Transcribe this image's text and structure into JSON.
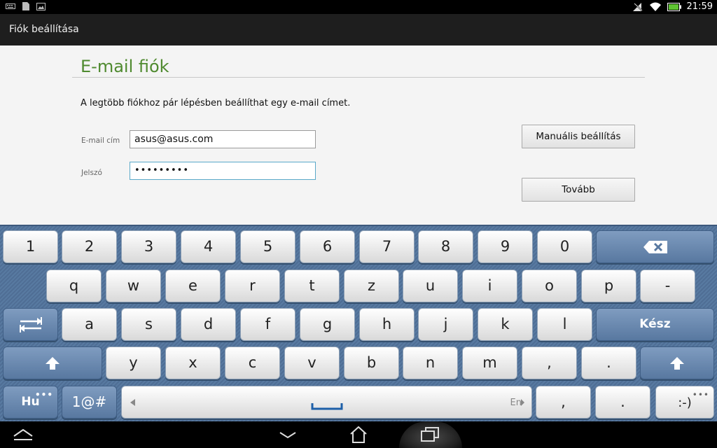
{
  "status": {
    "time": "21:59"
  },
  "app": {
    "title": "Fiók beállítása"
  },
  "page": {
    "heading": "E-mail fiók",
    "description": "A legtöbb fiókhoz pár lépésben beállíthat egy e-mail címet.",
    "email_label": "E-mail cím",
    "email_value": "asus@asus.com",
    "password_label": "Jelszó",
    "password_value": "•••••••••",
    "manual_button": "Manuális beállítás",
    "next_button": "Tovább"
  },
  "keyboard": {
    "row1": [
      "1",
      "2",
      "3",
      "4",
      "5",
      "6",
      "7",
      "8",
      "9",
      "0"
    ],
    "row2": [
      "q",
      "w",
      "e",
      "r",
      "t",
      "z",
      "u",
      "i",
      "o",
      "p",
      "-"
    ],
    "row3": [
      "a",
      "s",
      "d",
      "f",
      "g",
      "h",
      "j",
      "k",
      "l"
    ],
    "row4": [
      "y",
      "x",
      "c",
      "v",
      "b",
      "n",
      "m",
      ",",
      "."
    ],
    "done_label": "Kész",
    "lang_label": "Hu",
    "symbols_label": "1@#",
    "space_lang": "En",
    "comma": ",",
    "period": ".",
    "smiley": ":-)"
  },
  "colors": {
    "heading": "#4f8a2f",
    "keyboard_bg": "#587aa1",
    "focus_border": "#5aa9c9"
  }
}
